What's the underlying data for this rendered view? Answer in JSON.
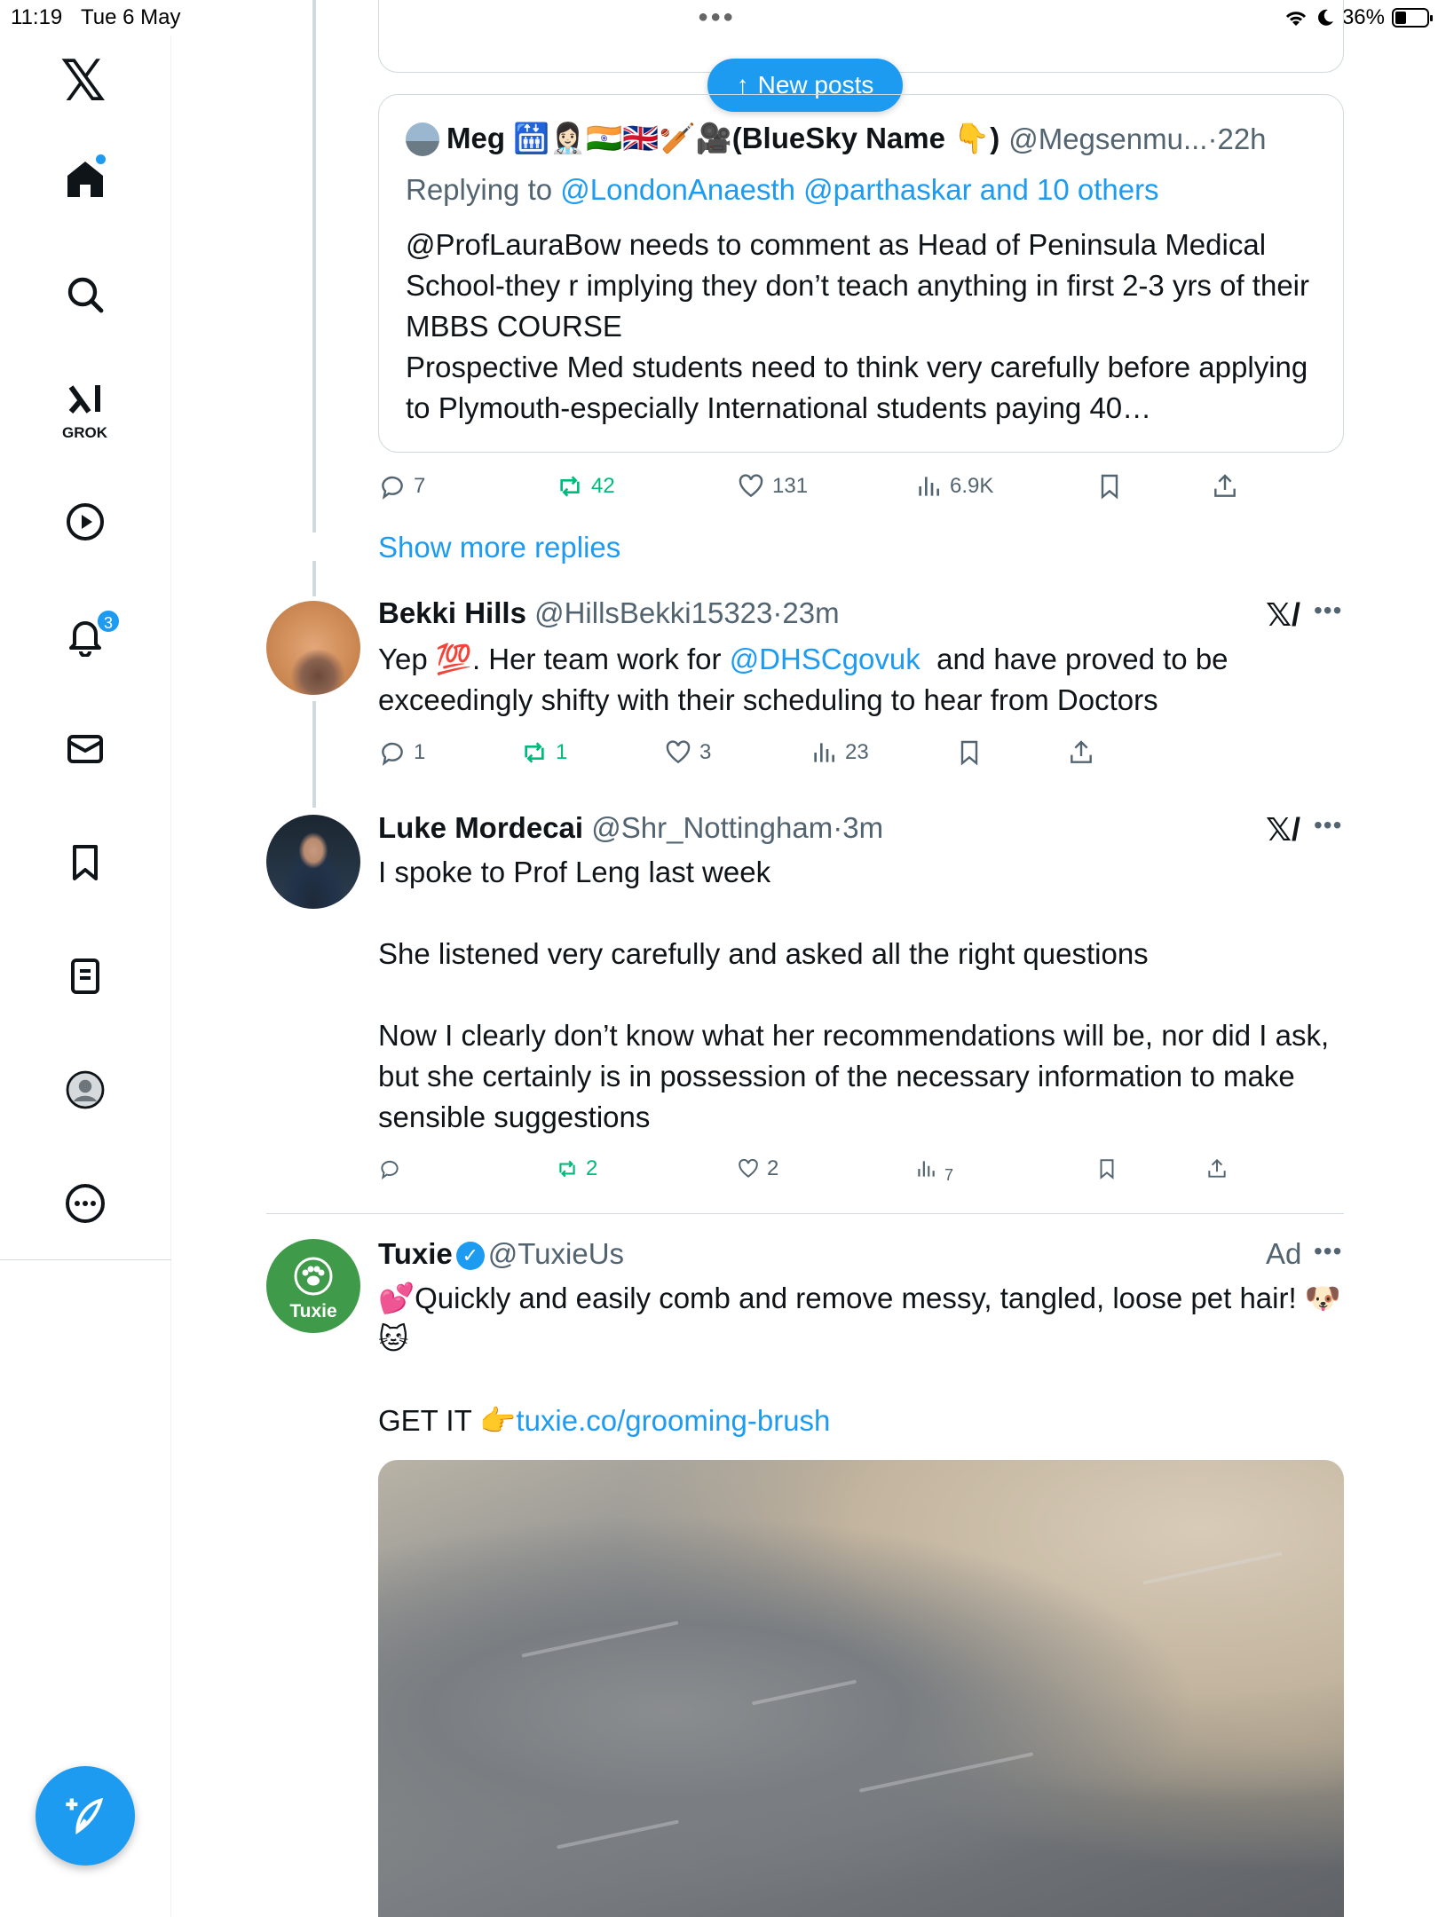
{
  "status_bar": {
    "time": "11:19",
    "date": "Tue 6 May",
    "battery": "36%",
    "battery_level": 0.36
  },
  "sidebar": {
    "grok_label": "GROK",
    "notifications_count": "3",
    "icons": [
      "x-logo-icon",
      "home-icon",
      "search-icon",
      "grok-icon",
      "video-icon",
      "notifications-icon",
      "messages-icon",
      "bookmarks-icon",
      "lists-icon",
      "profile-icon",
      "more-icon",
      "compose-icon"
    ]
  },
  "new_posts": {
    "label": "New posts"
  },
  "quote_tweet": {
    "name": "Meg 🛗👩🏻‍⚕️🇮🇳🇬🇧🏏🎥(BlueSky Name 👇)",
    "handle": "@Megsenmu...",
    "time": "22h",
    "replying_label": "Replying to",
    "replying_to": "@LondonAnaesth @parthaskar and 10 others",
    "mention": "@ProfLauraBow",
    "body_rest": " needs to comment as Head of Peninsula Medical School-they r implying they don’t teach anything in first 2-3 yrs of their MBBS COURSE\nProspective Med students need to think very carefully before applying to Plymouth-especially International students paying 40…",
    "replies": "7",
    "reposts": "42",
    "likes": "131",
    "views": "6.9K"
  },
  "show_more_replies": "Show more replies",
  "reply_1": {
    "name": "Bekki Hills",
    "handle": "@HillsBekki15323",
    "time": "23m",
    "body_start": "Yep 💯. Her team work for ",
    "mention": "@DHSCgovuk",
    "body_end": "  and have proved to be exceedingly shifty with their scheduling to hear from Doctors",
    "replies": "1",
    "reposts": "1",
    "likes": "3",
    "views": "23"
  },
  "reply_2": {
    "name": "Luke Mordecai",
    "handle": "@Shr_Nottingham",
    "time": "3m",
    "body": "I spoke to Prof Leng last week\n\nShe listened very carefully and asked all the right questions\n\nNow I clearly don’t know what her recommendations will be, nor did I ask, but she certainly is in possession of the necessary information to make sensible suggestions",
    "reposts": "2",
    "likes": "2",
    "views": "7"
  },
  "ad": {
    "name": "Tuxie",
    "handle": "@TuxieUs",
    "ad_label": "Ad",
    "avatar_text": "Tuxie",
    "body": "💕Quickly and easily comb and remove messy, tangled, loose pet hair! 🐶🐱",
    "cta_prefix": "GET IT 👉",
    "link": "tuxie.co/grooming-brush"
  },
  "colors": {
    "accent": "#1d9bf0",
    "repost_green": "#00ba7c",
    "secondary_text": "#536471",
    "border": "#cfd9de",
    "tuxie_green": "#3f9b4a"
  }
}
